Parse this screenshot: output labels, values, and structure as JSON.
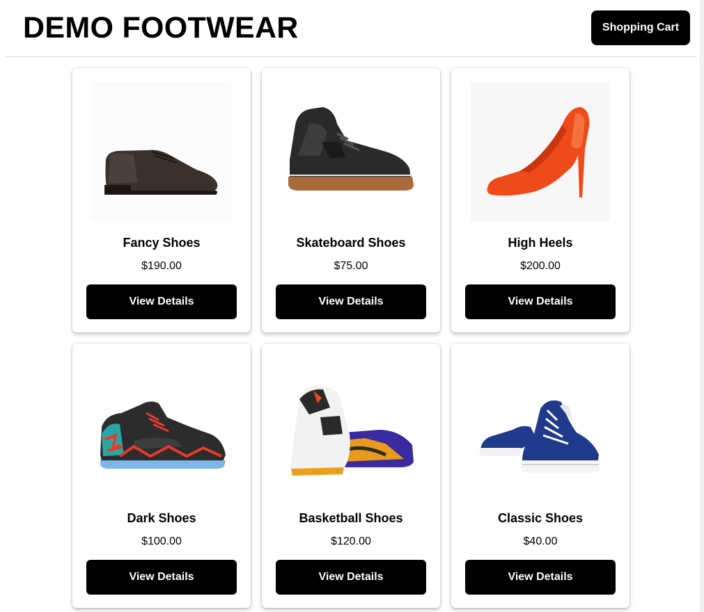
{
  "header": {
    "brand": "DEMO FOOTWEAR",
    "cart_label": "Shopping Cart"
  },
  "products": [
    {
      "name": "Fancy Shoes",
      "price": "$190.00",
      "button_label": "View Details",
      "icon": "oxford-shoe-icon"
    },
    {
      "name": "Skateboard Shoes",
      "price": "$75.00",
      "button_label": "View Details",
      "icon": "skate-shoe-icon"
    },
    {
      "name": "High Heels",
      "price": "$200.00",
      "button_label": "View Details",
      "icon": "high-heel-icon"
    },
    {
      "name": "Dark Shoes",
      "price": "$100.00",
      "button_label": "View Details",
      "icon": "sneaker-icon"
    },
    {
      "name": "Basketball Shoes",
      "price": "$120.00",
      "button_label": "View Details",
      "icon": "basketball-shoes-icon"
    },
    {
      "name": "Classic Shoes",
      "price": "$40.00",
      "button_label": "View Details",
      "icon": "canvas-sneakers-icon"
    }
  ],
  "colors": {
    "button_bg": "#000000",
    "button_text": "#ffffff",
    "heel_orange": "#f0501e",
    "canvas_blue": "#1f3a8a"
  }
}
